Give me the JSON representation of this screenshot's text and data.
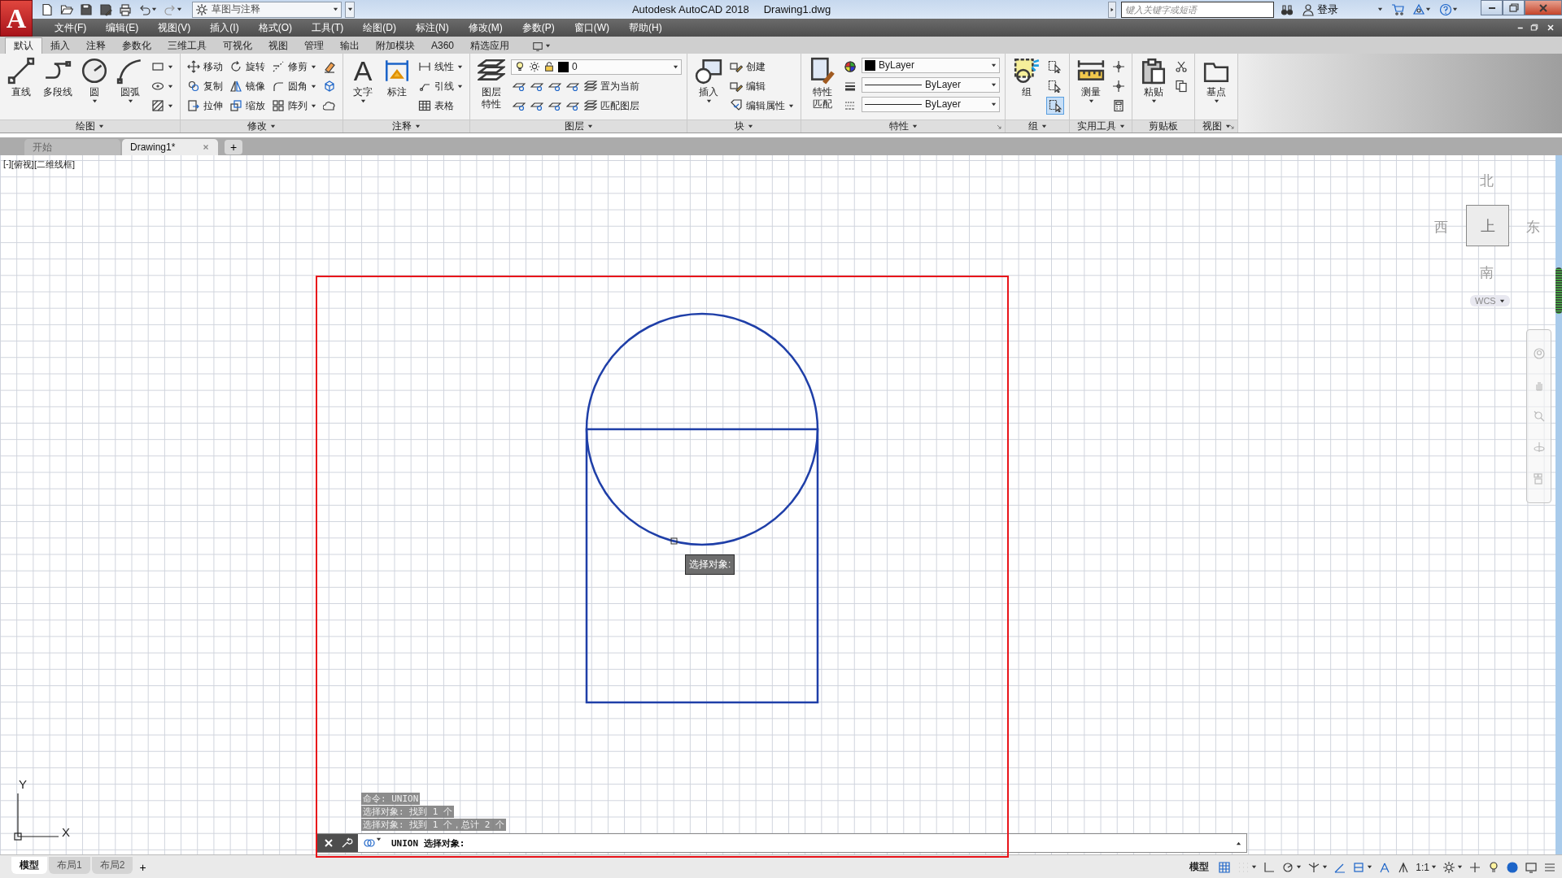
{
  "app_button": {
    "glyph": "A"
  },
  "quick_access": {
    "workspace": "草图与注释"
  },
  "title": {
    "app": "Autodesk AutoCAD 2018",
    "file": "Drawing1.dwg"
  },
  "search": {
    "placeholder": "键入关键字或短语"
  },
  "account": {
    "label": "登录"
  },
  "menu": [
    "文件(F)",
    "编辑(E)",
    "视图(V)",
    "插入(I)",
    "格式(O)",
    "工具(T)",
    "绘图(D)",
    "标注(N)",
    "修改(M)",
    "参数(P)",
    "窗口(W)",
    "帮助(H)"
  ],
  "ribbon_tabs": [
    {
      "label": "默认",
      "selected": true
    },
    {
      "label": "插入",
      "selected": false
    },
    {
      "label": "注释",
      "selected": false
    },
    {
      "label": "参数化",
      "selected": false
    },
    {
      "label": "三维工具",
      "selected": false
    },
    {
      "label": "可视化",
      "selected": false
    },
    {
      "label": "视图",
      "selected": false
    },
    {
      "label": "管理",
      "selected": false
    },
    {
      "label": "输出",
      "selected": false
    },
    {
      "label": "附加模块",
      "selected": false
    },
    {
      "label": "A360",
      "selected": false
    },
    {
      "label": "精选应用",
      "selected": false
    }
  ],
  "ribbon_panels": [
    {
      "title": "绘图",
      "caret": true,
      "launcher": false,
      "groups": [
        {
          "kind": "large",
          "label": "直线",
          "caret": false
        },
        {
          "kind": "large",
          "label": "多段线",
          "caret": false
        },
        {
          "kind": "large",
          "label": "圆",
          "caret": true
        },
        {
          "kind": "large",
          "label": "圆弧",
          "caret": true
        },
        {
          "kind": "column",
          "items": [
            {
              "kind": "tool",
              "caret": true
            },
            {
              "kind": "tool",
              "caret": true
            },
            {
              "kind": "tool",
              "caret": true
            }
          ]
        }
      ]
    },
    {
      "title": "修改",
      "caret": true,
      "launcher": false,
      "groups": [
        {
          "kind": "column",
          "items": [
            {
              "kind": "tool",
              "label": "移动",
              "caret": false
            },
            {
              "kind": "tool",
              "label": "复制",
              "caret": false
            },
            {
              "kind": "tool",
              "label": "拉伸",
              "caret": false
            }
          ]
        },
        {
          "kind": "column",
          "items": [
            {
              "kind": "tool",
              "label": "旋转",
              "caret": false
            },
            {
              "kind": "tool",
              "label": "镜像",
              "caret": false
            },
            {
              "kind": "tool",
              "label": "缩放",
              "caret": false
            }
          ]
        },
        {
          "kind": "column",
          "items": [
            {
              "kind": "tool",
              "label": "修剪",
              "caret": true
            },
            {
              "kind": "tool",
              "label": "圆角",
              "caret": true
            },
            {
              "kind": "tool",
              "label": "阵列",
              "caret": true
            }
          ]
        },
        {
          "kind": "column",
          "items": [
            {
              "kind": "tool",
              "caret": false
            },
            {
              "kind": "tool",
              "caret": false
            },
            {
              "kind": "tool",
              "caret": false
            }
          ]
        }
      ]
    },
    {
      "title": "注释",
      "caret": true,
      "launcher": false,
      "groups": [
        {
          "kind": "large",
          "glyph": "A",
          "label": "文字",
          "caret": true
        },
        {
          "kind": "large",
          "label": "标注",
          "caret": false
        },
        {
          "kind": "column",
          "items": [
            {
              "kind": "tool",
              "label": "线性",
              "caret": true
            },
            {
              "kind": "tool",
              "label": "引线",
              "caret": true
            },
            {
              "kind": "tool",
              "label": "表格",
              "caret": false
            }
          ]
        }
      ]
    },
    {
      "title": "图层",
      "caret": true,
      "launcher": false,
      "groups": [
        {
          "kind": "large",
          "label": "图层特性",
          "caret": false
        },
        {
          "kind": "column",
          "items": [
            {
              "kind": "combo",
              "value": "0"
            },
            {
              "kind": "tool",
              "label": "置为当前",
              "caret": false
            },
            {
              "kind": "tool",
              "label": "匹配图层",
              "caret": false
            }
          ]
        }
      ]
    },
    {
      "title": "块",
      "caret": true,
      "launcher": false,
      "groups": [
        {
          "kind": "large",
          "label": "插入",
          "caret": true
        },
        {
          "kind": "column",
          "items": [
            {
              "kind": "tool",
              "label": "创建",
              "caret": false
            },
            {
              "kind": "tool",
              "label": "编辑",
              "caret": false
            },
            {
              "kind": "tool",
              "label": "编辑属性",
              "caret": true
            }
          ]
        }
      ]
    },
    {
      "title": "特性",
      "caret": true,
      "launcher": true,
      "groups": [
        {
          "kind": "large",
          "label": "特性匹配",
          "caret": false
        },
        {
          "kind": "column",
          "items": [
            {
              "kind": "tool",
              "caret": false
            },
            {
              "kind": "tool",
              "caret": false
            },
            {
              "kind": "tool",
              "caret": false
            }
          ]
        },
        {
          "kind": "column",
          "items": [
            {
              "kind": "combo",
              "value": "ByLayer"
            },
            {
              "kind": "combo",
              "value": "ByLayer"
            },
            {
              "kind": "combo",
              "value": "ByLayer"
            }
          ]
        }
      ]
    },
    {
      "title": "组",
      "caret": true,
      "launcher": false,
      "groups": [
        {
          "kind": "large",
          "label": "组",
          "caret": false
        },
        {
          "kind": "column",
          "items": [
            {
              "kind": "tool",
              "caret": false,
              "on": false
            },
            {
              "kind": "tool",
              "caret": false,
              "on": false
            },
            {
              "kind": "tool",
              "caret": false,
              "on": true
            }
          ]
        }
      ]
    },
    {
      "title": "实用工具",
      "caret": true,
      "launcher": false,
      "groups": [
        {
          "kind": "large",
          "label": "测量",
          "caret": true
        },
        {
          "kind": "column",
          "items": [
            {
              "kind": "tool",
              "caret": false
            },
            {
              "kind": "tool",
              "caret": false
            },
            {
              "kind": "tool",
              "caret": false
            }
          ]
        }
      ]
    },
    {
      "title": "剪贴板",
      "caret": false,
      "launcher": false,
      "groups": [
        {
          "kind": "large",
          "label": "粘贴",
          "caret": true
        },
        {
          "kind": "column",
          "items": [
            {
              "kind": "tool",
              "caret": false
            },
            {
              "kind": "tool",
              "caret": false
            }
          ]
        }
      ]
    },
    {
      "title": "视图",
      "caret": true,
      "launcher": true,
      "groups": [
        {
          "kind": "large",
          "label": "基点",
          "caret": true
        }
      ]
    }
  ],
  "file_tabs": [
    {
      "label": "开始",
      "selected": false
    },
    {
      "label": "Drawing1*",
      "selected": true
    }
  ],
  "new_file_tab": "+",
  "viewport_controls": [
    "[-]",
    "[俯视]",
    "[二维线框]"
  ],
  "viewcube": {
    "north": "北",
    "west": "西",
    "east": "东",
    "south": "南",
    "face": "上",
    "ucs": "WCS"
  },
  "tooltip": "选择对象:",
  "ucs_axes": {
    "x": "X",
    "y": "Y"
  },
  "command_history": [
    "命令: UNION",
    "选择对象: 找到 1 个",
    "选择对象: 找到 1 个，总计 2 个"
  ],
  "command_line": {
    "prompt": "UNION 选择对象:"
  },
  "layout_tabs": [
    {
      "label": "模型",
      "selected": true
    },
    {
      "label": "布局1",
      "selected": false
    },
    {
      "label": "布局2",
      "selected": false
    }
  ],
  "new_layout_tab": "+",
  "status_bar": {
    "space": "模型",
    "scale": "1:1"
  }
}
